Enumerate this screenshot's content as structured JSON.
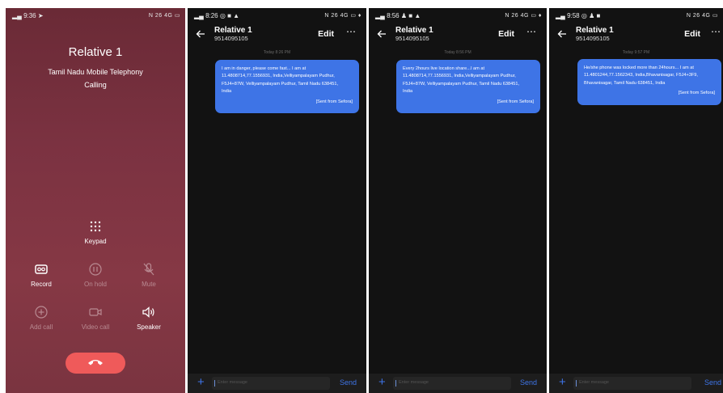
{
  "call": {
    "status_time": "9:36",
    "status_right": "N 26 4G ▭",
    "name": "Relative 1",
    "carrier": "Tamil Nadu Mobile Telephony",
    "status": "Calling",
    "keypad_label": "Keypad",
    "record_label": "Record",
    "hold_label": "On hold",
    "mute_label": "Mute",
    "add_call_label": "Add call",
    "video_call_label": "Video call",
    "speaker_label": "Speaker"
  },
  "chats": [
    {
      "status_time": "8:26",
      "status_right": "N 26 4G ▭ ♦",
      "contact_name": "Relative 1",
      "contact_number": "9514095105",
      "edit_label": "Edit",
      "more_label": "⋯",
      "timestamp": "Today 8:26 PM",
      "message": "I am in danger, please come fast... I am at\n11.4808714,77.1556931, India,Velliyampalayam Pudhur,\nF5J4+87W, Velliyampalayam Pudhur, Tamil Nadu 638451,\nIndia",
      "signature": "[Sent from Sefora]",
      "input_placeholder": "Enter message",
      "send_label": "Send"
    },
    {
      "status_time": "8:56",
      "status_right": "N 26 4G ▭ ♦",
      "contact_name": "Relative 1",
      "contact_number": "9514095105",
      "edit_label": "Edit",
      "more_label": "⋯",
      "timestamp": "Today 8:56 PM",
      "message": "Every 2hours live location share...I am at\n11.4808714,77.1556931, India,Velliyampalayam Pudhur,\nF5J4+87W, Velliyampalayam Pudhur, Tamil Nadu 638451,\nIndia",
      "signature": "[Sent from Sefora]",
      "input_placeholder": "Enter message",
      "send_label": "Send"
    },
    {
      "status_time": "9:58",
      "status_right": "N 26 4G ▭",
      "contact_name": "Relative 1",
      "contact_number": "9514095105",
      "edit_label": "Edit",
      "more_label": "⋯",
      "timestamp": "Today 9:57 PM",
      "message": "He/she phone was locked more than 24hours... I am at\n11.4801244,77.1562343, India,Bhavanisagar, F5J4+3F9,\nBhavanisagar, Tamil Nadu 638451, India",
      "signature": "[Sent from Sefora]",
      "input_placeholder": "Enter message",
      "send_label": "Send"
    }
  ],
  "colors": {
    "call_background": "#7b3241",
    "hangup": "#ef5a5a",
    "bubble": "#3e74e6",
    "chat_background": "#121212"
  },
  "icons": [
    "signal-icon",
    "location-arrow-icon",
    "keypad-icon",
    "record-icon",
    "hold-icon",
    "mute-icon",
    "add-call-icon",
    "video-call-icon",
    "speaker-icon",
    "hangup-icon",
    "back-arrow-icon",
    "plus-icon"
  ]
}
